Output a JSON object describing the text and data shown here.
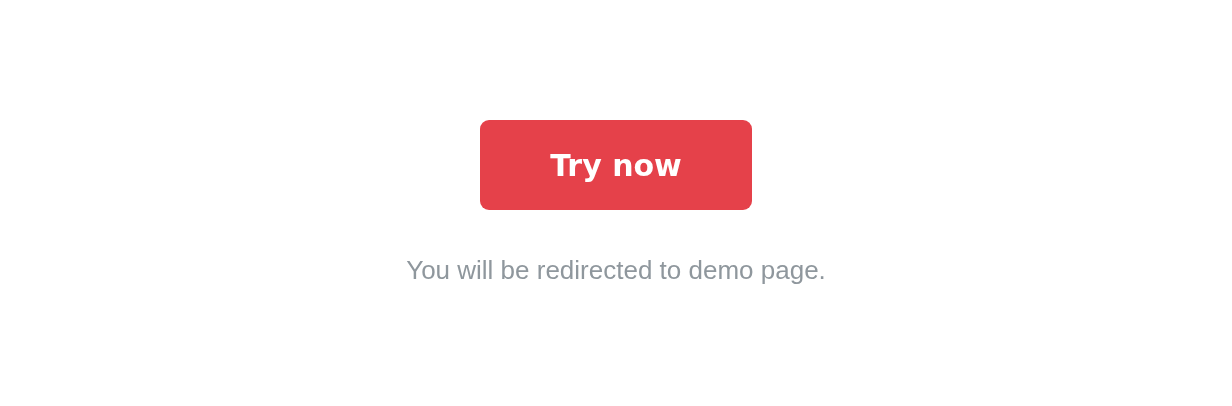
{
  "button": {
    "label": "Try now"
  },
  "note": "You will be redirected to demo page."
}
